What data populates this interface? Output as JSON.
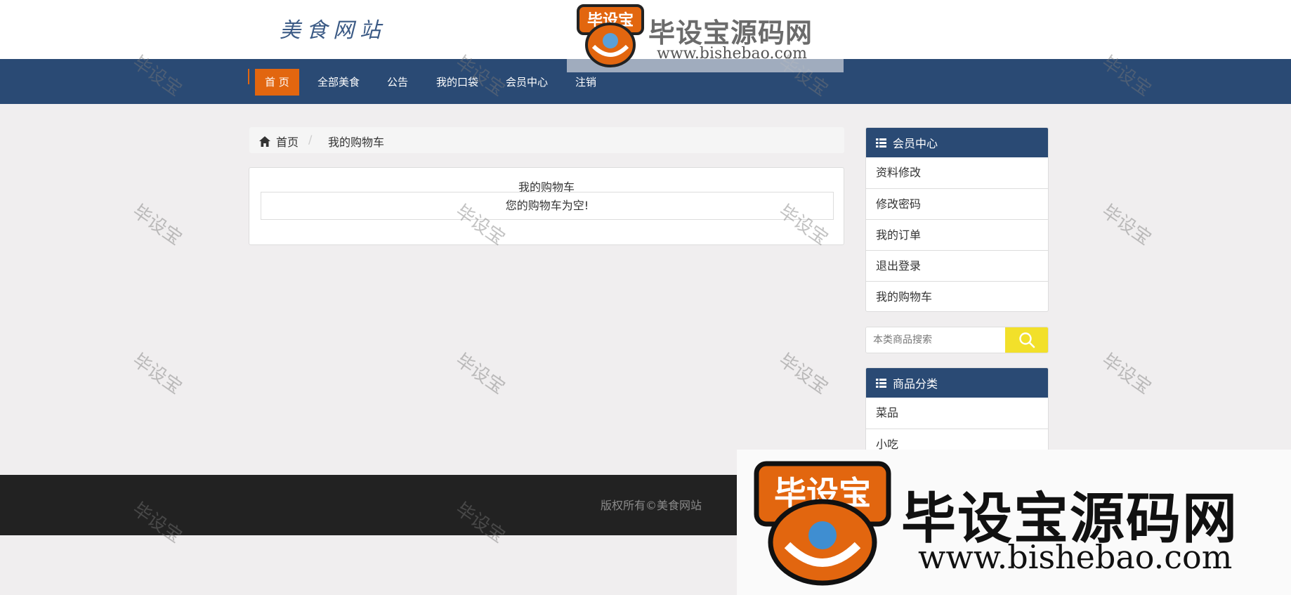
{
  "header": {
    "site_name": "美食网站"
  },
  "nav": {
    "items": [
      {
        "label": "首 页",
        "active": true
      },
      {
        "label": "全部美食",
        "active": false
      },
      {
        "label": "公告",
        "active": false
      },
      {
        "label": "我的口袋",
        "active": false
      },
      {
        "label": "会员中心",
        "active": false
      },
      {
        "label": "注销",
        "active": false
      }
    ]
  },
  "breadcrumb": {
    "home": "首页",
    "separator": "/",
    "current": "我的购物车"
  },
  "cart": {
    "title": "我的购物车",
    "empty_message": "您的购物车为空!"
  },
  "sidebar": {
    "member": {
      "title": "会员中心",
      "items": [
        "资料修改",
        "修改密码",
        "我的订单",
        "退出登录",
        "我的购物车"
      ]
    },
    "search": {
      "placeholder": "本类商品搜索"
    },
    "categories": {
      "title": "商品分类",
      "items": [
        "菜品",
        "小吃"
      ]
    }
  },
  "footer": {
    "copyright": "版权所有©美食网站"
  },
  "watermark": {
    "tile_text": "毕设宝",
    "badge_text": "毕设宝",
    "brand": "毕设宝源码网",
    "url": "www.bishebao.com"
  },
  "colors": {
    "nav_bg": "#2a4a74",
    "accent": "#e2660f",
    "search_button": "#f2e02a",
    "footer_bg": "#222222"
  }
}
